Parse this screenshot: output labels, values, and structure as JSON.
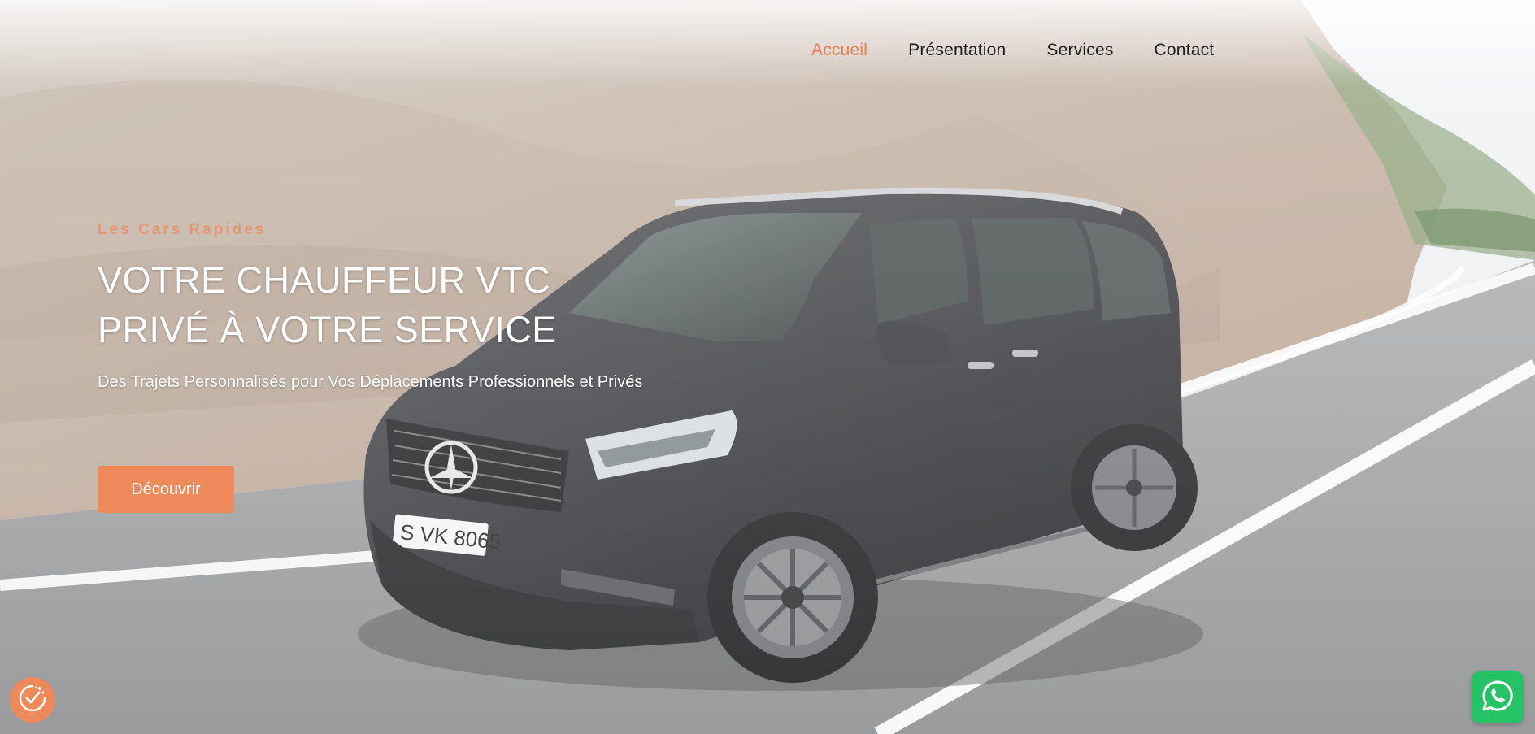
{
  "nav": {
    "items": [
      {
        "label": "Accueil",
        "active": true
      },
      {
        "label": "Présentation",
        "active": false
      },
      {
        "label": "Services",
        "active": false
      },
      {
        "label": "Contact",
        "active": false
      }
    ]
  },
  "hero": {
    "eyebrow": "Les Cars Rapides",
    "headline_line1": "VOTRE CHAUFFEUR VTC",
    "headline_line2": "PRIVÉ À VOTRE SERVICE",
    "subline": "Des Trajets Personnalisés pour Vos Déplacements Professionnels et Privés",
    "cta_label": "Découvrir",
    "background_image": "black-minivan-on-mountain-road-icon"
  },
  "widgets": {
    "cookie_icon": "cookie-consent-icon",
    "whatsapp_icon": "whatsapp-icon"
  },
  "colors": {
    "accent": "#ee8a5a",
    "nav_active": "#ea7d4e",
    "whatsapp": "#25c366"
  }
}
